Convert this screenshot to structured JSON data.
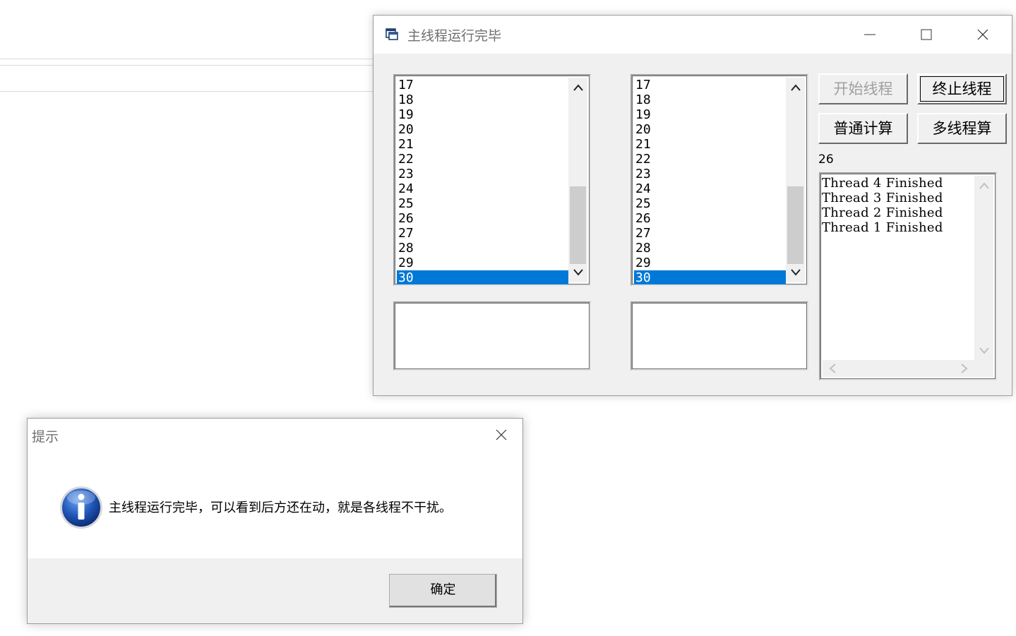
{
  "main_window": {
    "title": "主线程运行完毕",
    "list_left": {
      "items": [
        "17",
        "18",
        "19",
        "20",
        "21",
        "22",
        "23",
        "24",
        "25",
        "26",
        "27",
        "28",
        "29",
        "30"
      ],
      "selected_index": 13
    },
    "list_right": {
      "items": [
        "17",
        "18",
        "19",
        "20",
        "21",
        "22",
        "23",
        "24",
        "25",
        "26",
        "27",
        "28",
        "29",
        "30"
      ],
      "selected_index": 13
    },
    "edit_left_value": "",
    "edit_right_value": "",
    "buttons": {
      "start_thread": "开始线程",
      "stop_thread": "终止线程",
      "normal_calc": "普通计算",
      "multithread_calc": "多线程算"
    },
    "count_label": "26",
    "thread_log": [
      "Thread 4 Finished",
      "Thread 3 Finished",
      "Thread 2 Finished",
      "Thread 1 Finished"
    ]
  },
  "message_box": {
    "title": "提示",
    "icon": "info-icon",
    "message": "主线程运行完毕，可以看到后方还在动，就是各线程不干扰。",
    "ok_label": "确定"
  },
  "colors": {
    "selection": "#0078d7",
    "dialog_bg": "#f0f0f0"
  }
}
